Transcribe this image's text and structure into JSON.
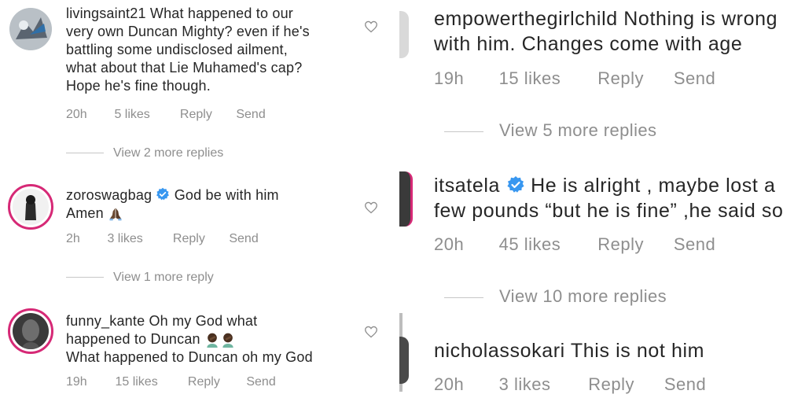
{
  "left": {
    "comments": [
      {
        "username": "livingsaint21",
        "lines": [
          "What happened to our",
          "very own Duncan Mighty? even if he's",
          "battling some undisclosed ailment,",
          "what about that Lie Muhamed's cap?",
          "Hope he's fine though."
        ],
        "time": "20h",
        "likes": "5 likes",
        "reply": "Reply",
        "send": "Send",
        "view_more": "View 2 more replies"
      },
      {
        "username": "zoroswagbag",
        "verified": true,
        "line1": "God be with him",
        "line2": "Amen",
        "time": "2h",
        "likes": "3 likes",
        "reply": "Reply",
        "send": "Send",
        "view_more": "View 1 more reply"
      },
      {
        "username": "funny_kante",
        "line1": "Oh my God what",
        "line2": "happened to Duncan",
        "line3": "What happened to Duncan oh my God",
        "time": "19h",
        "likes": "15 likes",
        "reply": "Reply",
        "send": "Send"
      }
    ]
  },
  "right": {
    "comments": [
      {
        "username": "empowerthegirlchild",
        "line1": "Nothing is wrong",
        "line2": "with him. Changes come with age",
        "time": "19h",
        "likes": "15 likes",
        "reply": "Reply",
        "send": "Send",
        "view_more": "View 5 more replies"
      },
      {
        "username": "itsatela",
        "verified": true,
        "line1": "He is alright , maybe lost a",
        "line2": "few pounds “but he is fine” ,he said so",
        "time": "20h",
        "likes": "45 likes",
        "reply": "Reply",
        "send": "Send",
        "view_more": "View 10 more replies"
      },
      {
        "username": "nicholassokari",
        "line1": "This is not him",
        "time": "20h",
        "likes": "3 likes",
        "reply": "Reply",
        "send": "Send"
      }
    ]
  },
  "colors": {
    "text": "#262626",
    "meta": "#8e8e8e",
    "verified": "#3897f0",
    "story_ring": "#d62976"
  },
  "icons": [
    "heart-icon",
    "verified-badge-icon",
    "praying-hands-emoji",
    "facepalm-emoji"
  ]
}
